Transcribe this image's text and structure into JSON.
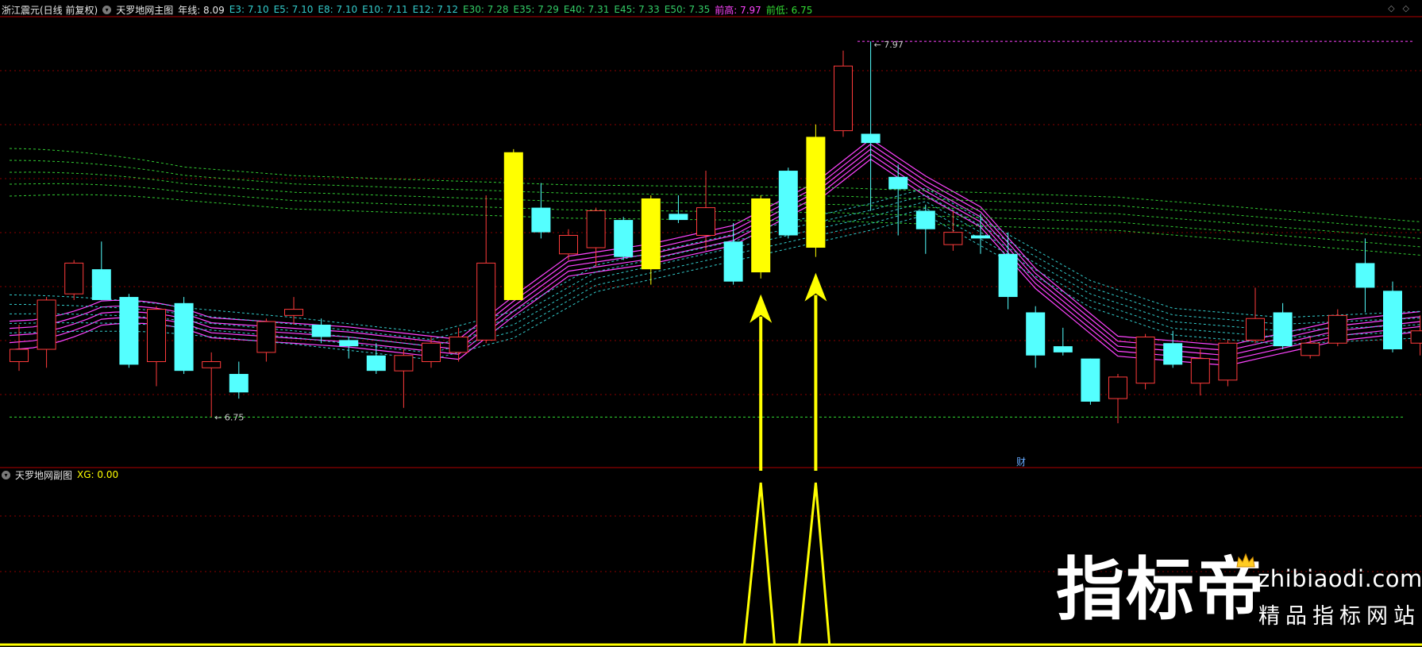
{
  "main_header": {
    "stock": "浙江震元(日线 前复权)",
    "indicator": "天罗地网主图",
    "nianxian": "年线: 8.09",
    "ema": [
      "E3: 7.10",
      "E5: 7.10",
      "E8: 7.10",
      "E10: 7.11",
      "E12: 7.12",
      "E30: 7.28",
      "E35: 7.29",
      "E40: 7.31",
      "E45: 7.33",
      "E50: 7.35"
    ],
    "high": "前高: 7.97",
    "low": "前低: 6.75"
  },
  "sub_header": {
    "indicator": "天罗地网副图",
    "xg": "XG: 0.00"
  },
  "markers": {
    "high_label": "7.97",
    "low_label": "6.75",
    "cai": "财"
  },
  "watermark": {
    "name": "指标帝",
    "url": "zhibiaodi.com",
    "slogan": "精品指标网站"
  },
  "colors": {
    "up": "#ff3b3b",
    "down": "#54ffff",
    "highlight": "#ffff00",
    "fast_ma": "#ff44ff",
    "slow_ma": "#33cc33",
    "mid_ma": "#33cccc",
    "grid": "#8a0000"
  },
  "chart_data": {
    "type": "candlestick",
    "ylim": [
      6.64,
      8.04
    ],
    "high_value": 7.97,
    "low_value": 6.75,
    "candles": [
      {
        "o": 6.93,
        "c": 6.97,
        "h": 7.05,
        "l": 6.9,
        "hl": false
      },
      {
        "o": 6.97,
        "c": 7.13,
        "h": 7.14,
        "l": 6.91,
        "hl": false
      },
      {
        "o": 7.15,
        "c": 7.25,
        "h": 7.26,
        "l": 7.13,
        "hl": false
      },
      {
        "o": 7.23,
        "c": 7.13,
        "h": 7.32,
        "l": 7.13,
        "hl": false
      },
      {
        "o": 7.14,
        "c": 6.92,
        "h": 7.15,
        "l": 6.91,
        "hl": false
      },
      {
        "o": 6.93,
        "c": 7.1,
        "h": 7.11,
        "l": 6.85,
        "hl": false
      },
      {
        "o": 7.12,
        "c": 6.9,
        "h": 7.14,
        "l": 6.89,
        "hl": false
      },
      {
        "o": 6.91,
        "c": 6.93,
        "h": 6.96,
        "l": 6.75,
        "hl": false
      },
      {
        "o": 6.89,
        "c": 6.83,
        "h": 6.93,
        "l": 6.81,
        "hl": false
      },
      {
        "o": 6.96,
        "c": 7.06,
        "h": 7.07,
        "l": 6.93,
        "hl": false
      },
      {
        "o": 7.08,
        "c": 7.1,
        "h": 7.14,
        "l": 7.05,
        "hl": false
      },
      {
        "o": 7.05,
        "c": 7.01,
        "h": 7.07,
        "l": 6.99,
        "hl": false
      },
      {
        "o": 7.0,
        "c": 6.98,
        "h": 7.01,
        "l": 6.94,
        "hl": false
      },
      {
        "o": 6.95,
        "c": 6.9,
        "h": 6.99,
        "l": 6.89,
        "hl": false
      },
      {
        "o": 6.9,
        "c": 6.95,
        "h": 6.97,
        "l": 6.78,
        "hl": false
      },
      {
        "o": 6.93,
        "c": 6.99,
        "h": 7.01,
        "l": 6.91,
        "hl": false
      },
      {
        "o": 6.96,
        "c": 7.01,
        "h": 7.04,
        "l": 6.93,
        "hl": false
      },
      {
        "o": 7.0,
        "c": 7.25,
        "h": 7.47,
        "l": 6.99,
        "hl": false
      },
      {
        "o": 7.13,
        "c": 7.61,
        "h": 7.62,
        "l": 7.13,
        "hl": true
      },
      {
        "o": 7.43,
        "c": 7.35,
        "h": 7.51,
        "l": 7.33,
        "hl": false
      },
      {
        "o": 7.28,
        "c": 7.34,
        "h": 7.36,
        "l": 7.26,
        "hl": false
      },
      {
        "o": 7.3,
        "c": 7.42,
        "h": 7.43,
        "l": 7.24,
        "hl": false
      },
      {
        "o": 7.39,
        "c": 7.27,
        "h": 7.4,
        "l": 7.26,
        "hl": false
      },
      {
        "o": 7.23,
        "c": 7.46,
        "h": 7.47,
        "l": 7.18,
        "hl": true
      },
      {
        "o": 7.41,
        "c": 7.39,
        "h": 7.47,
        "l": 7.38,
        "hl": false
      },
      {
        "o": 7.34,
        "c": 7.43,
        "h": 7.55,
        "l": 7.29,
        "hl": false
      },
      {
        "o": 7.32,
        "c": 7.19,
        "h": 7.38,
        "l": 7.18,
        "hl": false
      },
      {
        "o": 7.22,
        "c": 7.46,
        "h": 7.47,
        "l": 7.2,
        "hl": true
      },
      {
        "o": 7.55,
        "c": 7.34,
        "h": 7.56,
        "l": 7.33,
        "hl": false
      },
      {
        "o": 7.3,
        "c": 7.66,
        "h": 7.7,
        "l": 7.27,
        "hl": true
      },
      {
        "o": 7.68,
        "c": 7.89,
        "h": 7.94,
        "l": 7.66,
        "hl": false
      },
      {
        "o": 7.67,
        "c": 7.64,
        "h": 7.97,
        "l": 7.42,
        "hl": false
      },
      {
        "o": 7.53,
        "c": 7.49,
        "h": 7.57,
        "l": 7.34,
        "hl": false
      },
      {
        "o": 7.42,
        "c": 7.36,
        "h": 7.44,
        "l": 7.28,
        "hl": false
      },
      {
        "o": 7.31,
        "c": 7.35,
        "h": 7.42,
        "l": 7.29,
        "hl": false
      },
      {
        "o": 7.34,
        "c": 7.33,
        "h": 7.41,
        "l": 7.28,
        "hl": false
      },
      {
        "o": 7.28,
        "c": 7.14,
        "h": 7.35,
        "l": 7.1,
        "hl": false
      },
      {
        "o": 7.09,
        "c": 6.95,
        "h": 7.11,
        "l": 6.91,
        "hl": false
      },
      {
        "o": 6.98,
        "c": 6.96,
        "h": 7.04,
        "l": 6.95,
        "hl": false
      },
      {
        "o": 6.94,
        "c": 6.8,
        "h": 6.94,
        "l": 6.79,
        "hl": false
      },
      {
        "o": 6.81,
        "c": 6.88,
        "h": 6.89,
        "l": 6.73,
        "hl": false
      },
      {
        "o": 6.86,
        "c": 7.01,
        "h": 7.02,
        "l": 6.84,
        "hl": false
      },
      {
        "o": 6.99,
        "c": 6.92,
        "h": 7.03,
        "l": 6.91,
        "hl": false
      },
      {
        "o": 6.86,
        "c": 6.94,
        "h": 6.97,
        "l": 6.82,
        "hl": false
      },
      {
        "o": 6.87,
        "c": 6.99,
        "h": 7.0,
        "l": 6.85,
        "hl": false
      },
      {
        "o": 7.0,
        "c": 7.07,
        "h": 7.17,
        "l": 6.99,
        "hl": false
      },
      {
        "o": 7.09,
        "c": 6.98,
        "h": 7.12,
        "l": 6.97,
        "hl": false
      },
      {
        "o": 6.95,
        "c": 6.99,
        "h": 7.01,
        "l": 6.94,
        "hl": false
      },
      {
        "o": 6.99,
        "c": 7.08,
        "h": 7.1,
        "l": 6.98,
        "hl": false
      },
      {
        "o": 7.25,
        "c": 7.17,
        "h": 7.33,
        "l": 7.09,
        "hl": false
      },
      {
        "o": 7.16,
        "c": 6.97,
        "h": 7.19,
        "l": 6.96,
        "hl": false
      },
      {
        "o": 6.99,
        "c": 7.03,
        "h": 7.08,
        "l": 6.95,
        "hl": false
      }
    ],
    "ma_groups": [
      {
        "name": "",
        "role": "fast",
        "start": [
          7.0,
          7.03
        ],
        "knots": [
          [
            0,
            7.06
          ],
          [
            3,
            7.16
          ],
          [
            7,
            7.04
          ],
          [
            12,
            7.01
          ],
          [
            16,
            6.97
          ],
          [
            18,
            7.11
          ],
          [
            20,
            7.24
          ],
          [
            23,
            7.28
          ],
          [
            26,
            7.34
          ],
          [
            29,
            7.48
          ],
          [
            31,
            7.62
          ],
          [
            33,
            7.5
          ],
          [
            35,
            7.4
          ],
          [
            37,
            7.2
          ],
          [
            40,
            6.98
          ],
          [
            44,
            6.95
          ],
          [
            48,
            7.03
          ],
          [
            51,
            7.06
          ]
        ]
      },
      {
        "name": "",
        "role": "mid",
        "start": [
          7.05,
          7.12
        ],
        "knots": [
          [
            0,
            7.09
          ],
          [
            5,
            7.07
          ],
          [
            10,
            7.03
          ],
          [
            15,
            6.98
          ],
          [
            18,
            7.05
          ],
          [
            21,
            7.2
          ],
          [
            26,
            7.3
          ],
          [
            31,
            7.4
          ],
          [
            33,
            7.45
          ],
          [
            36,
            7.3
          ],
          [
            39,
            7.15
          ],
          [
            42,
            7.06
          ],
          [
            46,
            7.03
          ],
          [
            51,
            7.05
          ]
        ]
      },
      {
        "name": "",
        "role": "slow",
        "start": [
          7.5,
          7.59
        ],
        "knots": [
          [
            0,
            7.55
          ],
          [
            10,
            7.48
          ],
          [
            20,
            7.45
          ],
          [
            30,
            7.44
          ],
          [
            40,
            7.41
          ],
          [
            51,
            7.33
          ]
        ]
      }
    ],
    "signals": [
      27,
      29
    ],
    "xg_pulses": [
      {
        "start": 26.4,
        "peak": 27,
        "end": 27.5
      },
      {
        "start": 28.4,
        "peak": 29,
        "end": 29.5
      }
    ],
    "xg_value": 0.0
  }
}
